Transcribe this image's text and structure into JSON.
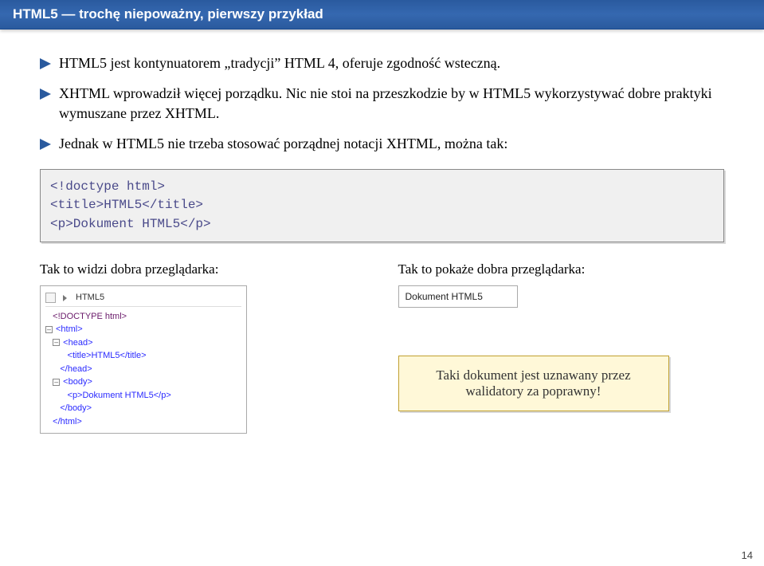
{
  "header": {
    "title": "HTML5 — trochę niepoważny, pierwszy przykład"
  },
  "bullets": [
    "HTML5 jest kontynuatorem „tradycji” HTML 4, oferuje zgodność wsteczną.",
    "XHTML wprowadził więcej porządku. Nic nie stoi na przeszkodzie by w HTML5 wykorzystywać dobre praktyki wymuszane przez XHTML.",
    "Jednak w HTML5 nie trzeba stosować porządnej notacji XHTML, można tak:"
  ],
  "code": {
    "line1": "<!doctype html>",
    "line2": "<title>HTML5</title>",
    "line3": "<p>Dokument HTML5</p>"
  },
  "columns": {
    "left_label": "Tak to widzi dobra przeglądarka:",
    "right_label": "Tak to pokaże dobra przeglądarka:"
  },
  "tree": {
    "top_label": "HTML5",
    "lines": {
      "doctype": "<!DOCTYPE html>",
      "html": "<html>",
      "head": "<head>",
      "title": "<title>HTML5</title>",
      "head_close": "</head>",
      "body": "<body>",
      "p": "<p>Dokument HTML5</p>",
      "body_close": "</body>",
      "html_close": "</html>"
    }
  },
  "render": {
    "text": "Dokument HTML5"
  },
  "callout": {
    "text": "Taki dokument jest uznawany przez walidatory za poprawny!"
  },
  "pagenum": "14"
}
